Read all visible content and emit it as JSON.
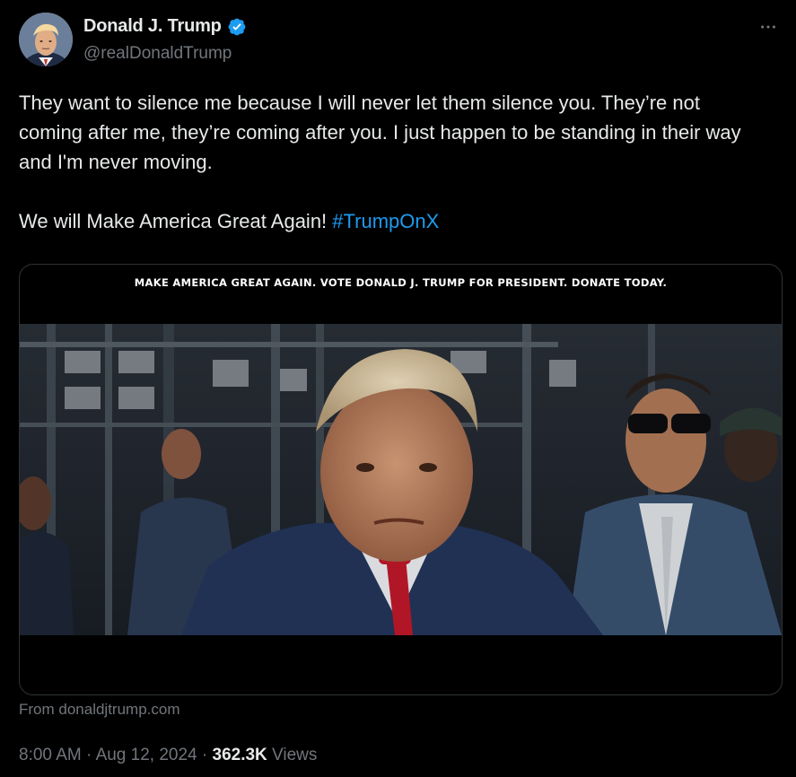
{
  "author": {
    "display_name": "Donald J. Trump",
    "handle": "@realDonaldTrump",
    "verified": true,
    "verified_color": "#1d9bf0"
  },
  "menu": {
    "icon": "more-horizontal-icon"
  },
  "tweet": {
    "lines": [
      "They want to silence me because I will never let them silence you. They’re not coming after me, they’re coming after you. I just happen to be standing in their way and I'm never moving."
    ],
    "closing_text": "We will Make America Great Again! ",
    "hashtag": "#TrumpOnX"
  },
  "media": {
    "banner_text": "MAKE AMERICA GREAT AGAIN. VOTE DONALD J. TRUMP FOR PRESIDENT. DONATE TODAY."
  },
  "source": {
    "text": "From donaldjtrump.com"
  },
  "meta": {
    "time": "8:00 AM",
    "separator": " · ",
    "date": "Aug 12, 2024",
    "views_count": "362.3K",
    "views_label": " Views"
  },
  "colors": {
    "background": "#000000",
    "text_primary": "#e7e9ea",
    "text_secondary": "#71767b",
    "link": "#1d9bf0",
    "border": "#2f3336"
  }
}
